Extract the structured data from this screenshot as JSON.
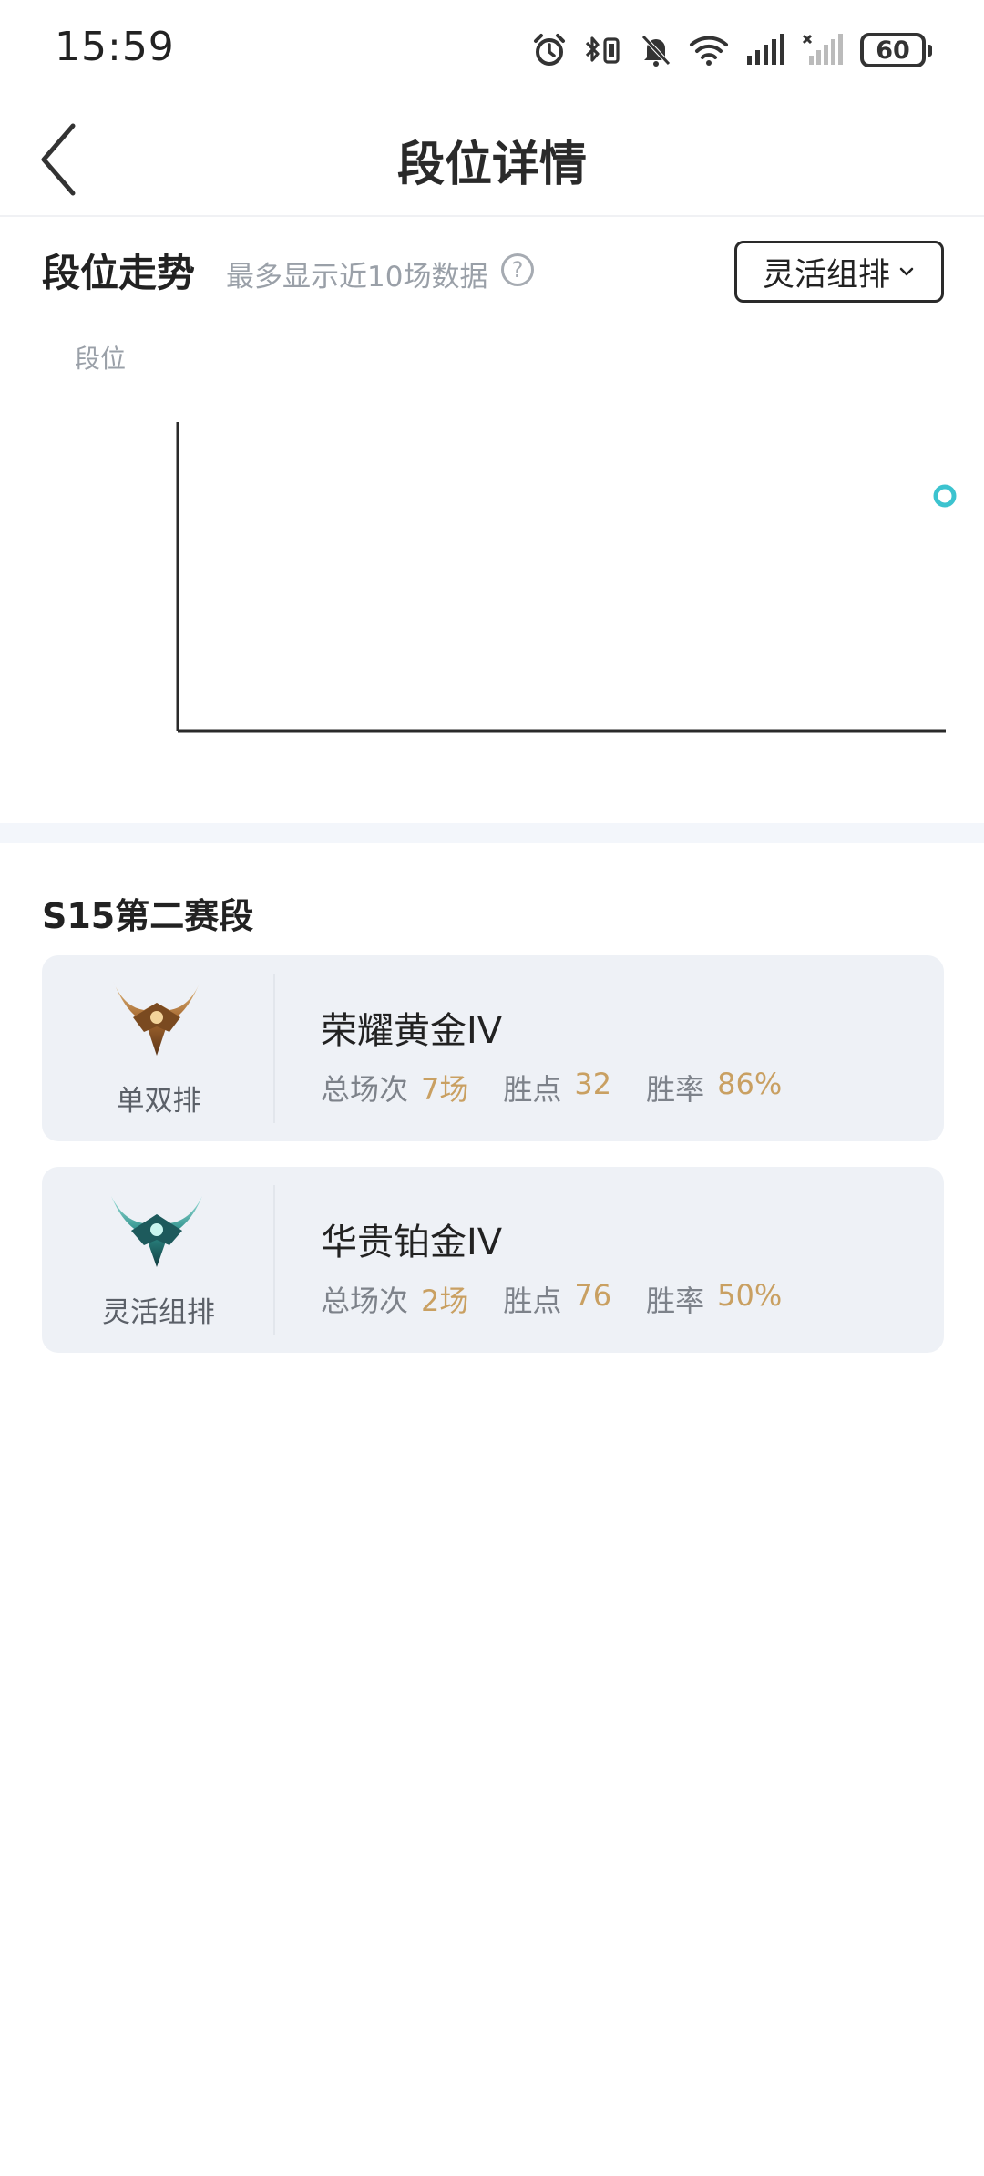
{
  "status_bar": {
    "time": "15:59",
    "battery": "60",
    "icons": [
      "alarm-icon",
      "bluetooth-vibrate-icon",
      "mute-bell-icon",
      "wifi-icon",
      "signal-icon",
      "signal-no-service-icon",
      "battery-icon"
    ]
  },
  "header": {
    "title": "段位详情",
    "back_icon": "chevron-left-icon"
  },
  "trend": {
    "title": "段位走势",
    "hint": "最多显示近10场数据",
    "help_symbol": "?",
    "mode_selected": "灵活组排",
    "y_axis_label": "段位"
  },
  "chart_data": {
    "type": "line",
    "ylabel": "段位",
    "xlabel": "",
    "series": [
      {
        "points": [
          {
            "x": 1,
            "label": ""
          }
        ]
      }
    ],
    "colors": {
      "point": "#3cc3cf",
      "axis": "#2a2a2a"
    },
    "grid": false
  },
  "season": {
    "title": "S15第二赛段",
    "cards": [
      {
        "queue": "单双排",
        "rank": "荣耀黄金IV",
        "emblem": "gold-emblem-icon",
        "stats": [
          {
            "label": "总场次",
            "value": "7场"
          },
          {
            "label": "胜点",
            "value": "32"
          },
          {
            "label": "胜率",
            "value": "86%"
          }
        ]
      },
      {
        "queue": "灵活组排",
        "rank": "华贵铂金IV",
        "emblem": "platinum-emblem-icon",
        "stats": [
          {
            "label": "总场次",
            "value": "2场"
          },
          {
            "label": "胜点",
            "value": "76"
          },
          {
            "label": "胜率",
            "value": "50%"
          }
        ]
      }
    ]
  },
  "colors": {
    "stat_value": "#c9a062",
    "card_bg": "#eef1f6",
    "chart_point": "#3cc3cf"
  }
}
